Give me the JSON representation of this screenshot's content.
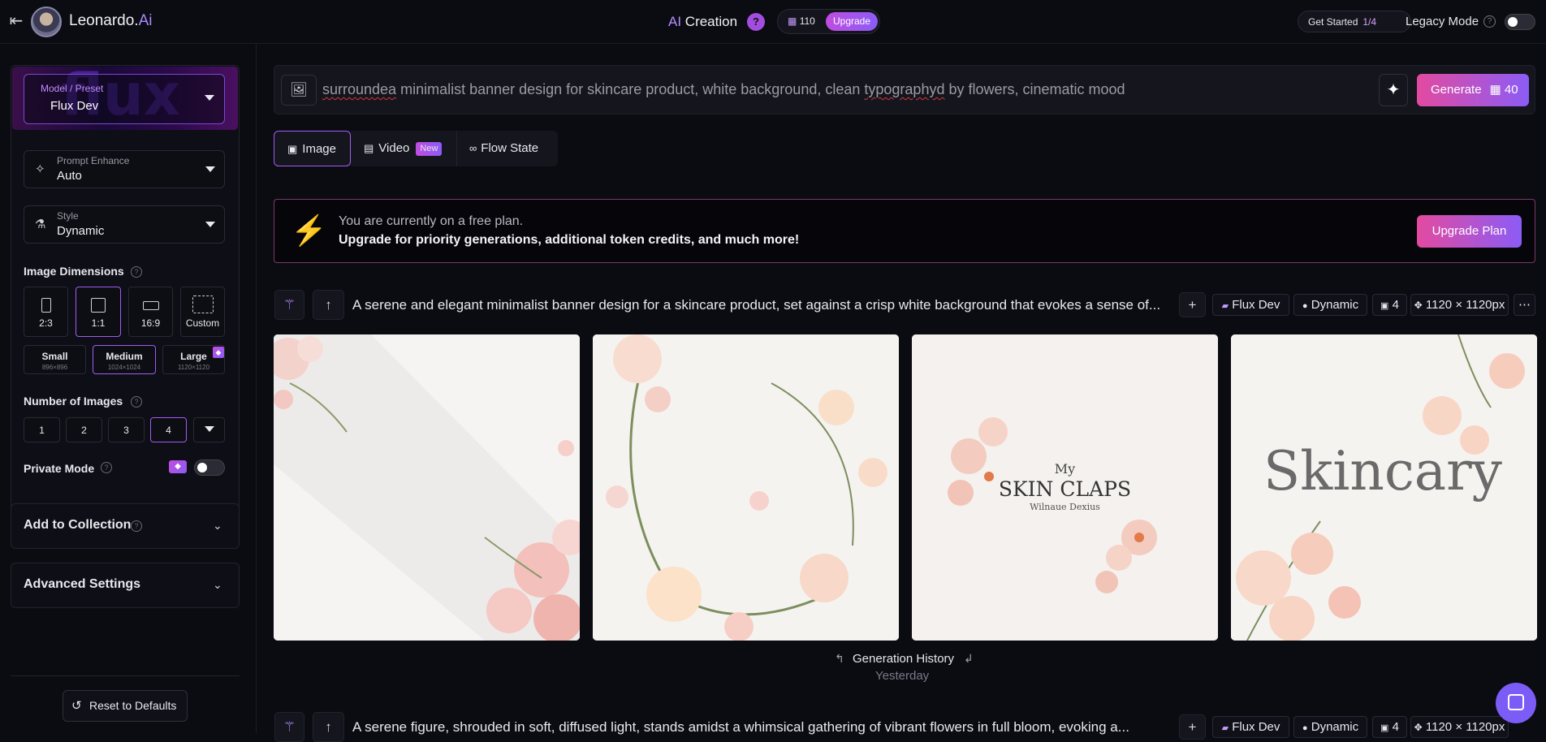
{
  "topbar": {
    "back_icon": "exit-icon",
    "brand_name": "Leonardo.",
    "brand_suffix": "Ai",
    "section_prefix": "AI",
    "section_title": " Creation",
    "help_label": "?",
    "tokens": "110",
    "upgrade_label": "Upgrade",
    "get_started_label": "Get Started",
    "get_started_progress": "1/4",
    "legacy_mode_label": "Legacy Mode",
    "legacy_mode_on": false
  },
  "sidebar": {
    "model": {
      "label": "Model / Preset",
      "value": "Flux Dev"
    },
    "prompt_enhance": {
      "label": "Prompt Enhance",
      "value": "Auto"
    },
    "style": {
      "label": "Style",
      "value": "Dynamic"
    },
    "dimensions": {
      "title": "Image Dimensions",
      "ratios": [
        {
          "label": "2:3",
          "active": false
        },
        {
          "label": "1:1",
          "active": true
        },
        {
          "label": "16:9",
          "active": false
        },
        {
          "label": "Custom",
          "active": false
        }
      ],
      "sizes": [
        {
          "label": "Small",
          "sub": "896×896",
          "active": false
        },
        {
          "label": "Medium",
          "sub": "1024×1024",
          "active": true
        },
        {
          "label": "Large",
          "sub": "1120×1120",
          "active": false
        }
      ]
    },
    "num_images": {
      "title": "Number of Images",
      "options": [
        {
          "label": "1",
          "active": false
        },
        {
          "label": "2",
          "active": false
        },
        {
          "label": "3",
          "active": false
        },
        {
          "label": "4",
          "active": true
        }
      ]
    },
    "private_mode": {
      "label": "Private Mode",
      "on": false
    },
    "add_to_collection": "Add to Collection",
    "advanced_settings": "Advanced Settings",
    "reset_label": "Reset to Defaults"
  },
  "prompt": {
    "word1": "surroundea",
    "mid": " minimalist banner design for skincare product, white background, clean ",
    "word2": "typographyd",
    "end": " by flowers, cinematic mood",
    "generate_label": "Generate",
    "generate_cost": "40"
  },
  "tabs": [
    {
      "label": "Image",
      "active": true,
      "icon": "image-icon"
    },
    {
      "label": "Video",
      "active": false,
      "icon": "video-icon",
      "badge": "New"
    },
    {
      "label": "Flow State",
      "active": false,
      "icon": "link-icon"
    }
  ],
  "banner": {
    "line1": "You are currently on a free plan.",
    "line2": "Upgrade for priority generations, additional token credits, and much more!",
    "button": "Upgrade Plan"
  },
  "generations": [
    {
      "prompt": "A serene and elegant minimalist banner design for a skincare product, set against a crisp white background that evokes a sense of...",
      "model": "Flux Dev",
      "style": "Dynamic",
      "count": "4",
      "size": "1120 × 1120px",
      "images": [
        {
          "alt": "pink flowers corner"
        },
        {
          "alt": "floral wreath"
        },
        {
          "alt": "skin claps label",
          "text_small": "My",
          "text_big": "SKIN CLAPS",
          "text_sub": "Wilnaue Dexius"
        },
        {
          "alt": "skincary script",
          "text_big": "Skincary"
        }
      ]
    },
    {
      "prompt": "A serene figure, shrouded in soft, diffused light, stands amidst a whimsical gathering of vibrant flowers in full bloom, evoking a...",
      "model": "Flux Dev",
      "style": "Dynamic",
      "count": "4",
      "size": "1120 × 1120px"
    }
  ],
  "history": {
    "label": "Generation History",
    "sub": "Yesterday"
  }
}
